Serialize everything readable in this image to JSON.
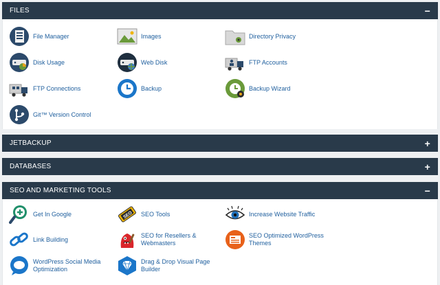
{
  "files": {
    "title": "FILES",
    "toggle": "−",
    "items": [
      {
        "label": "File Manager",
        "icon": "file-manager-icon"
      },
      {
        "label": "Images",
        "icon": "images-icon"
      },
      {
        "label": "Directory Privacy",
        "icon": "directory-privacy-icon"
      },
      {
        "label": "Disk Usage",
        "icon": "disk-usage-icon"
      },
      {
        "label": "Web Disk",
        "icon": "web-disk-icon"
      },
      {
        "label": "FTP Accounts",
        "icon": "ftp-accounts-icon"
      },
      {
        "label": "FTP Connections",
        "icon": "ftp-connections-icon"
      },
      {
        "label": "Backup",
        "icon": "backup-icon"
      },
      {
        "label": "Backup Wizard",
        "icon": "backup-wizard-icon"
      },
      {
        "label": "Git™ Version Control",
        "icon": "git-icon"
      }
    ]
  },
  "jetbackup": {
    "title": "JETBACKUP",
    "toggle": "+"
  },
  "databases": {
    "title": "DATABASES",
    "toggle": "+"
  },
  "seo": {
    "title": "SEO AND MARKETING TOOLS",
    "toggle": "−",
    "items": [
      {
        "label": "Get In Google",
        "icon": "magnifier-plus-icon"
      },
      {
        "label": "SEO Tools",
        "icon": "seo-tag-icon"
      },
      {
        "label": "Increase Website Traffic",
        "icon": "eye-icon"
      },
      {
        "label": "Link Building",
        "icon": "chain-link-icon"
      },
      {
        "label": "SEO for Resellers & Webmasters",
        "icon": "monster-icon"
      },
      {
        "label": "SEO Optimized WordPress Themes",
        "icon": "wordpress-themes-icon"
      },
      {
        "label": "WordPress Social Media Optimization",
        "icon": "speech-bubble-icon"
      },
      {
        "label": "Drag & Drop Visual Page Builder",
        "icon": "diamond-icon"
      }
    ]
  },
  "colors": {
    "header_bg": "#293a4a",
    "link": "#1f5f9e",
    "page_bg": "#eef0f2"
  }
}
